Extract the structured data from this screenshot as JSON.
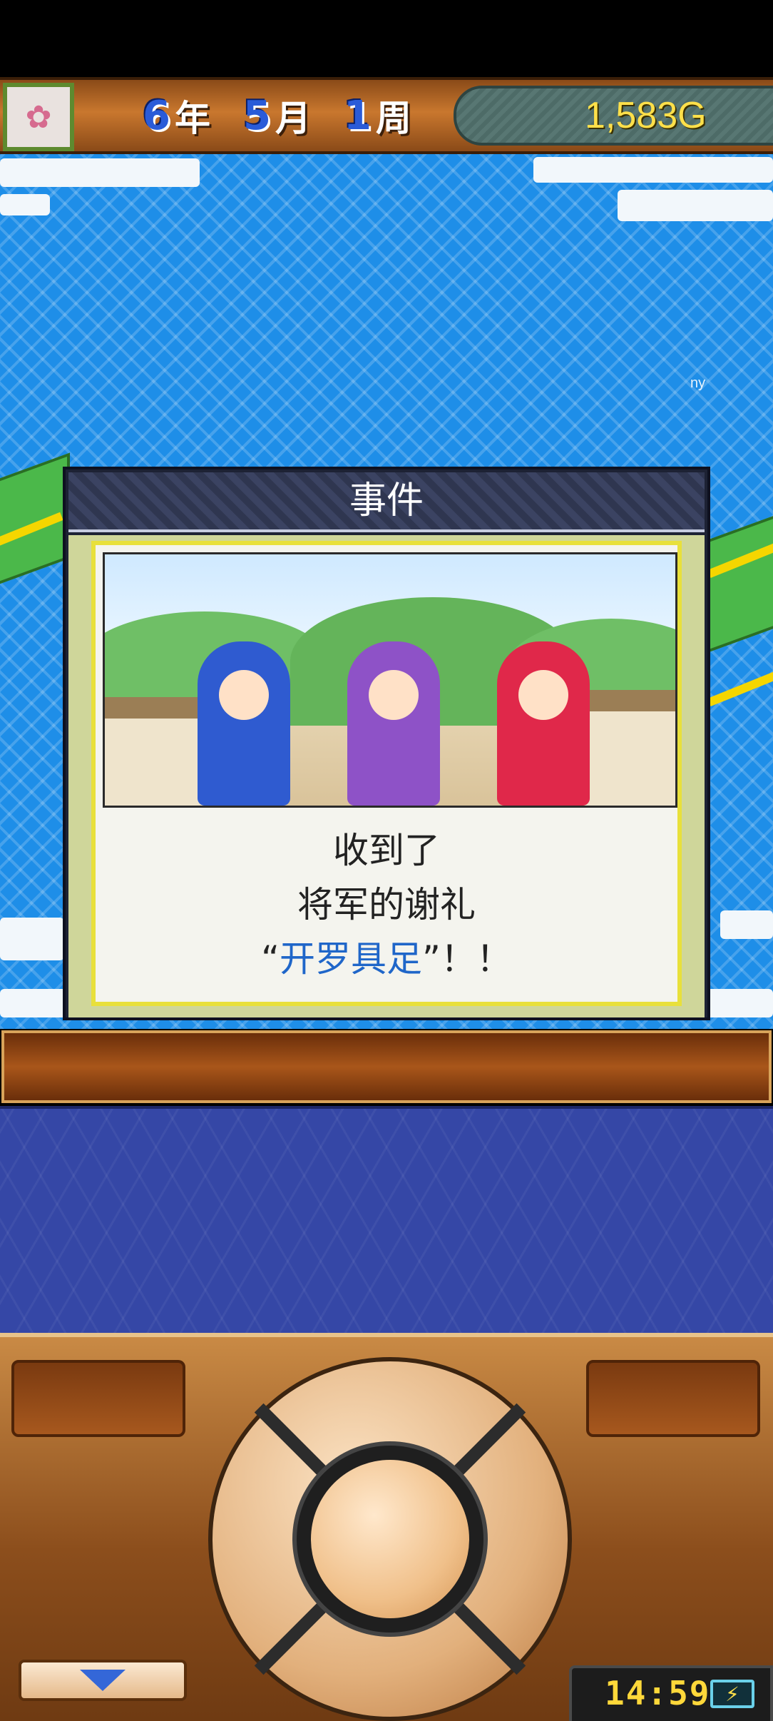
{
  "header": {
    "year": "6",
    "year_unit": "年",
    "month": "5",
    "month_unit": "月",
    "week": "1",
    "week_unit": "周",
    "gold": "1,583G",
    "avatar_icon": "cherry-blossom-icon"
  },
  "map": {
    "watermark": "ny"
  },
  "event_dialog": {
    "title": "事件",
    "line1": "收到了",
    "line2": "将军的谢礼",
    "item_open_quote": "“",
    "item_name": "开罗具足",
    "item_close_quote": "”！！"
  },
  "controls": {
    "collapse_icon": "chevron-down-icon",
    "dpad_icon": "dpad-icon"
  },
  "status": {
    "clock": "14:59",
    "battery_icon": "battery-charging-icon"
  },
  "colors": {
    "gold_text": "#ffe04a",
    "date_number": "#2a5bd8",
    "item_highlight": "#1f66c9",
    "sea": "#1e8ee8"
  }
}
